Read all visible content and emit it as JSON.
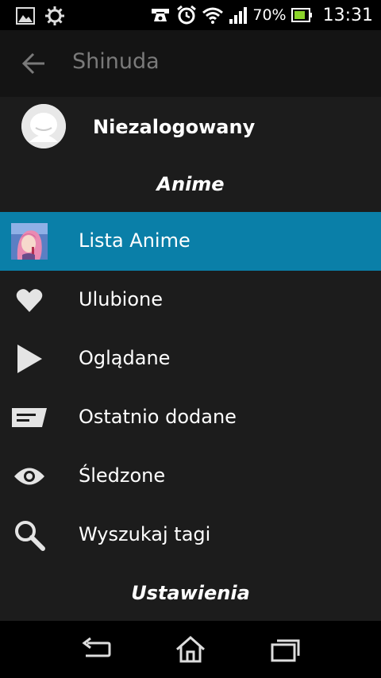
{
  "status_bar": {
    "battery_percent": "70%",
    "clock": "13:31",
    "icons": [
      "image-icon",
      "settings-icon",
      "handset-icon",
      "alarm-icon",
      "wifi-icon",
      "signal-icon",
      "battery-icon"
    ]
  },
  "action_bar": {
    "title": "Shinuda",
    "back_icon": "back-arrow-icon"
  },
  "drawer": {
    "profile": {
      "name": "Niezalogowany",
      "avatar_icon": "avatar-icon"
    },
    "sections": [
      {
        "header": "Anime",
        "items": [
          {
            "label": "Lista Anime",
            "icon": "anime-thumbnail",
            "active": true
          },
          {
            "label": "Ulubione",
            "icon": "heart-icon",
            "active": false
          },
          {
            "label": "Oglądane",
            "icon": "play-icon",
            "active": false
          },
          {
            "label": "Ostatnio dodane",
            "icon": "comment-icon",
            "active": false
          },
          {
            "label": "Śledzone",
            "icon": "eye-icon",
            "active": false
          },
          {
            "label": "Wyszukaj tagi",
            "icon": "search-icon",
            "active": false
          }
        ]
      },
      {
        "header": "Ustawienia",
        "items": []
      }
    ]
  },
  "navigation_bar": {
    "buttons": [
      "back-nav-icon",
      "home-nav-icon",
      "recents-nav-icon"
    ]
  },
  "colors": {
    "active_item": "#0a7fa8",
    "drawer_background": "#1c1c1c",
    "action_bar": "#141414"
  }
}
